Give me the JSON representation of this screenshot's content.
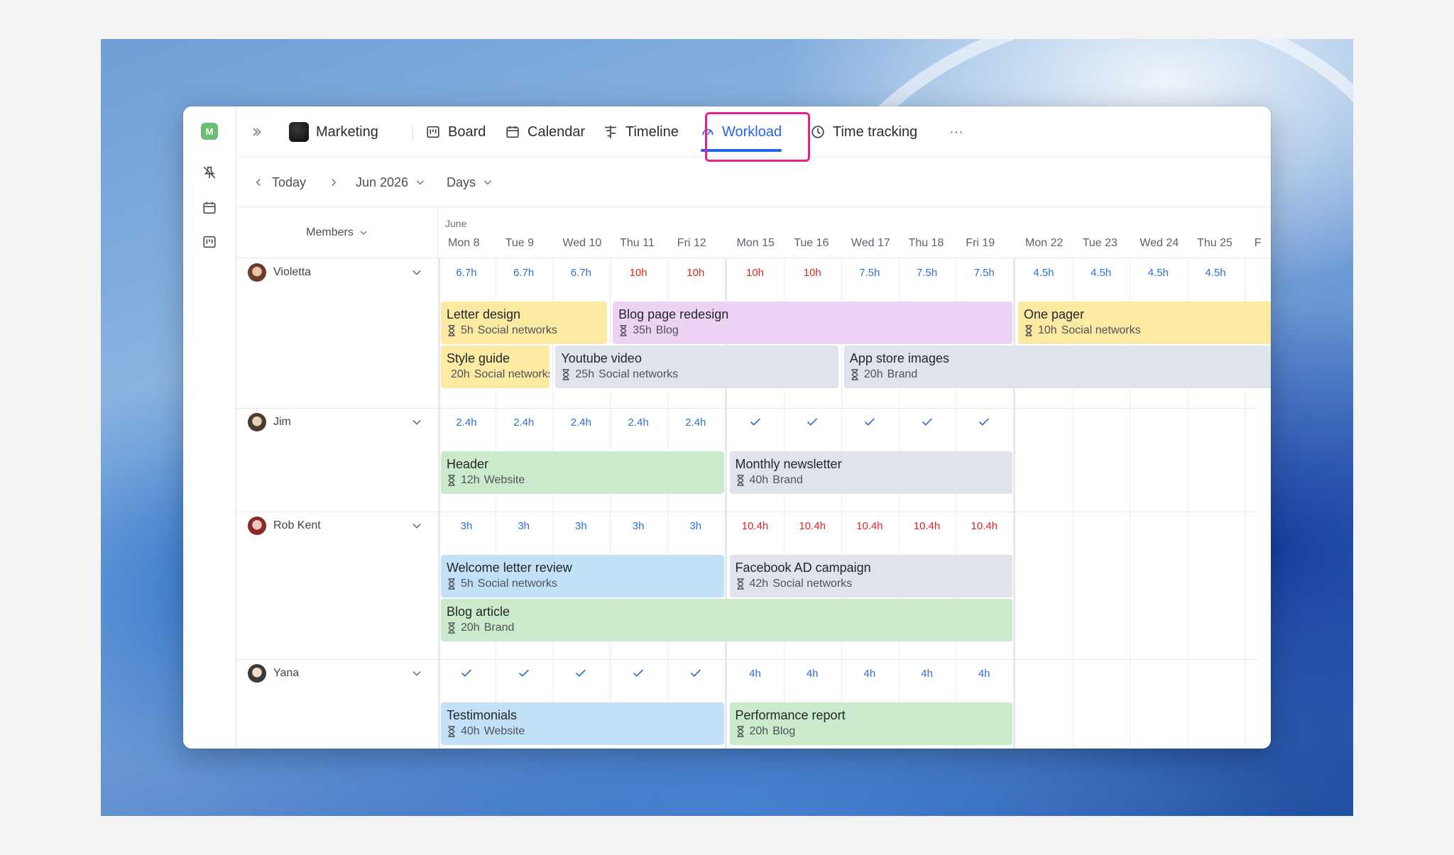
{
  "nav": {
    "project": "Marketing",
    "board": "Board",
    "calendar": "Calendar",
    "timeline": "Timeline",
    "workload": "Workload",
    "time_tracking": "Time tracking",
    "more": "···"
  },
  "workspace_badge": "M",
  "toolbar": {
    "today": "Today",
    "period": "Jun 2026",
    "scale": "Days"
  },
  "grid": {
    "members_label": "Members",
    "month": "June",
    "days": [
      "Mon 8",
      "Tue 9",
      "Wed 10",
      "Thu 11",
      "Fri 12",
      "Mon 15",
      "Tue 16",
      "Wed 17",
      "Thu 18",
      "Fri 19",
      "Mon 22",
      "Tue 23",
      "Wed 24",
      "Thu 25",
      "F"
    ]
  },
  "members": [
    {
      "name": "Violetta",
      "hours": [
        "6.7h",
        "6.7h",
        "6.7h",
        "10h",
        "10h",
        "10h",
        "10h",
        "7.5h",
        "7.5h",
        "7.5h",
        "4.5h",
        "4.5h",
        "4.5h",
        "4.5h"
      ],
      "tasks": [
        {
          "name": "Letter design",
          "hours": "5h",
          "project": "Social networks"
        },
        {
          "name": "Blog page redesign",
          "hours": "35h",
          "project": "Blog"
        },
        {
          "name": "One pager",
          "hours": "10h",
          "project": "Social networks"
        },
        {
          "name": "Style guide",
          "hours": "20h",
          "project": "Social networks"
        },
        {
          "name": "Youtube video",
          "hours": "25h",
          "project": "Social networks"
        },
        {
          "name": "App store images",
          "hours": "20h",
          "project": "Brand"
        }
      ]
    },
    {
      "name": "Jim",
      "hours": [
        "2.4h",
        "2.4h",
        "2.4h",
        "2.4h",
        "2.4h",
        "✓",
        "✓",
        "✓",
        "✓",
        "✓"
      ],
      "tasks": [
        {
          "name": "Header",
          "hours": "12h",
          "project": "Website"
        },
        {
          "name": "Monthly newsletter",
          "hours": "40h",
          "project": "Brand"
        }
      ]
    },
    {
      "name": "Rob Kent",
      "hours": [
        "3h",
        "3h",
        "3h",
        "3h",
        "3h",
        "10.4h",
        "10.4h",
        "10.4h",
        "10.4h",
        "10.4h"
      ],
      "tasks": [
        {
          "name": "Welcome letter review",
          "hours": "5h",
          "project": "Social networks"
        },
        {
          "name": "Facebook AD campaign",
          "hours": "42h",
          "project": "Social networks"
        },
        {
          "name": "Blog article",
          "hours": "20h",
          "project": "Brand"
        }
      ]
    },
    {
      "name": "Yana",
      "hours": [
        "✓",
        "✓",
        "✓",
        "✓",
        "✓",
        "4h",
        "4h",
        "4h",
        "4h",
        "4h"
      ],
      "tasks": [
        {
          "name": "Testimonials",
          "hours": "40h",
          "project": "Website"
        },
        {
          "name": "Performance report",
          "hours": "20h",
          "project": "Blog"
        }
      ]
    }
  ],
  "zoom": {
    "in": "+",
    "out": "−"
  },
  "colors": {
    "accent": "#2563eb",
    "highlight": "#e7218b",
    "over": "#dc2626"
  }
}
